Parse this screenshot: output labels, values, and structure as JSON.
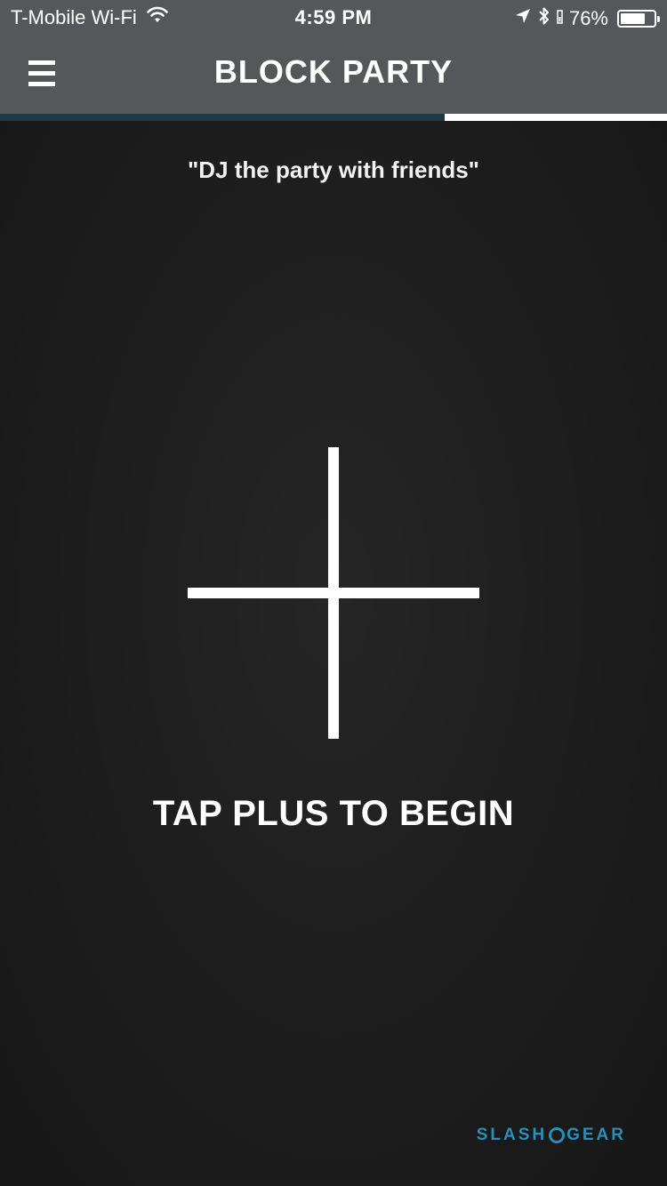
{
  "status_bar": {
    "carrier": "T-Mobile Wi-Fi",
    "time": "4:59 PM",
    "battery_percent": "76%",
    "battery_level": 0.76,
    "icons": [
      "wifi-icon",
      "location-arrow-icon",
      "bluetooth-icon",
      "battery-icon"
    ]
  },
  "nav": {
    "title": "BLOCK PARTY",
    "menu_icon": "hamburger-menu-icon"
  },
  "progress": {
    "fraction": 0.667,
    "fill_color": "#1e3a44",
    "track_color": "#ffffff"
  },
  "main": {
    "tagline": "\"DJ the party with friends\"",
    "plus_icon": "plus-icon",
    "cta": "TAP PLUS TO BEGIN"
  },
  "watermark": {
    "left": "SLASH",
    "right": "GEAR",
    "color": "#2a8fb8"
  },
  "colors": {
    "header_bg": "#55575a",
    "body_bg": "#1d1d1d",
    "text": "#ffffff"
  }
}
